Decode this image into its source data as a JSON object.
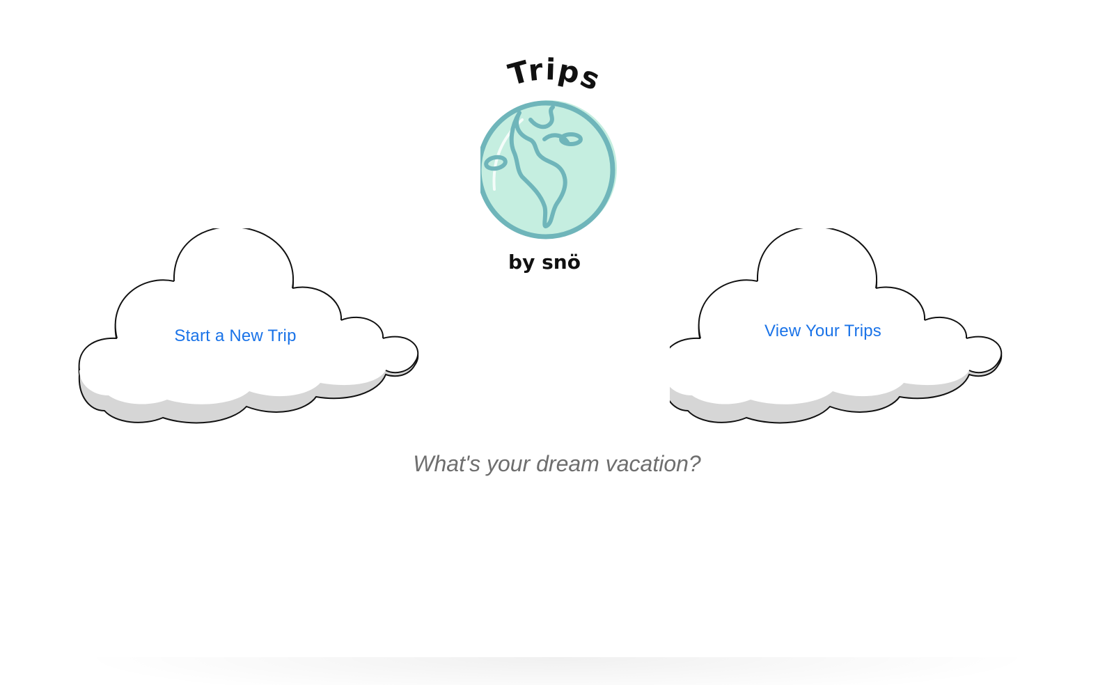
{
  "logo": {
    "title": "Trips",
    "byline": "by snö",
    "globe_fill": "#c5eee0",
    "globe_stroke": "#6fb5ba"
  },
  "actions": {
    "start_label": "Start a New Trip",
    "view_label": "View Your Trips",
    "link_color": "#1a73e8"
  },
  "tagline": "What's your dream vacation?"
}
